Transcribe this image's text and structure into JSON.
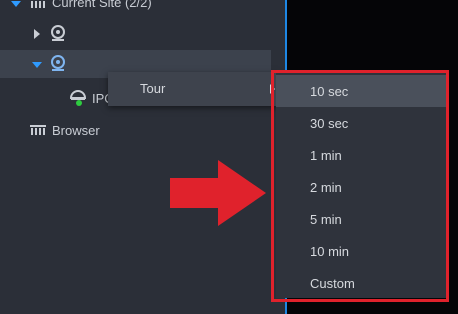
{
  "tree": {
    "root_label": "Current Site (2/2)",
    "device_child_label": "IPC",
    "browser_label": "Browser"
  },
  "context_menu": {
    "tour_label": "Tour"
  },
  "tour_submenu": {
    "items": [
      {
        "label": "10 sec",
        "highlighted": true
      },
      {
        "label": "30 sec"
      },
      {
        "label": "1 min"
      },
      {
        "label": "2 min"
      },
      {
        "label": "5 min"
      },
      {
        "label": "10 min"
      },
      {
        "label": "Custom"
      }
    ]
  },
  "colors": {
    "accent": "#1e88e5",
    "highlight_box": "#e0222c",
    "arrow": "#e0222c",
    "online_status": "#2ecc40"
  },
  "icons": [
    "site-icon",
    "camera-icon",
    "dome-camera-icon",
    "browser-icon",
    "red-arrow-icon"
  ]
}
